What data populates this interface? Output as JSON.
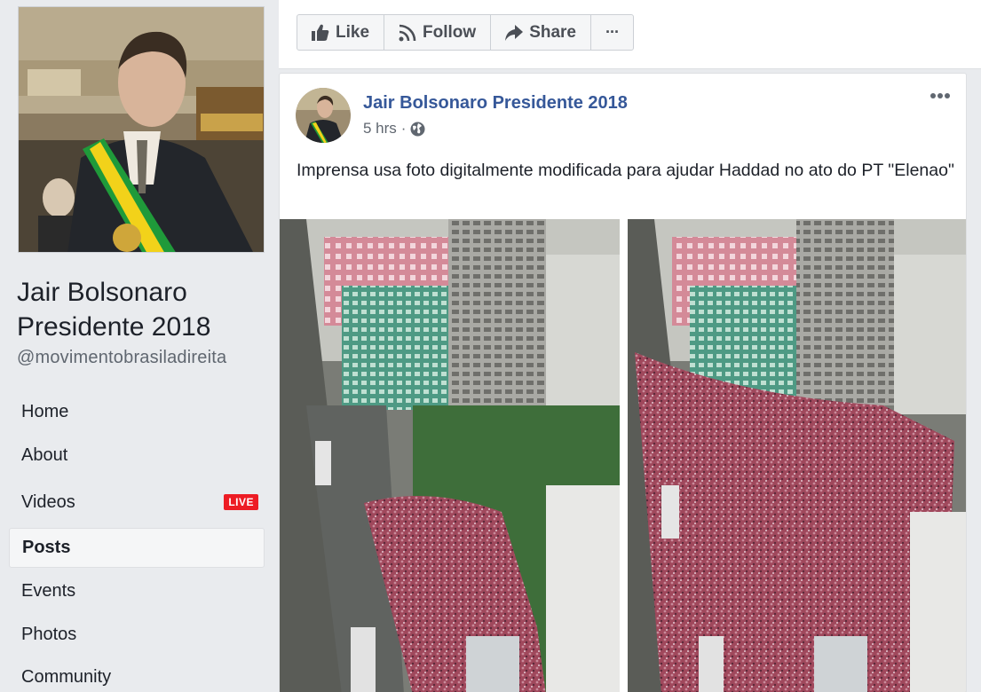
{
  "page": {
    "name": "Jair Bolsonaro Presidente 2018",
    "handle": "@movimentobrasiladireita"
  },
  "nav": {
    "items": [
      {
        "label": "Home"
      },
      {
        "label": "About"
      },
      {
        "label": "Videos",
        "badge": "LIVE"
      },
      {
        "label": "Posts",
        "active": true
      },
      {
        "label": "Events"
      },
      {
        "label": "Photos"
      },
      {
        "label": "Community"
      }
    ]
  },
  "actions": {
    "like": "Like",
    "follow": "Follow",
    "share": "Share",
    "more": "···"
  },
  "post": {
    "author": "Jair Bolsonaro Presidente 2018",
    "time": "5 hrs",
    "separator": "·",
    "privacy_icon": "globe-icon",
    "text": "Imprensa usa foto digitalmente modificada para ajudar Haddad no ato do PT \"Elenao\"",
    "menu_icon": "more-dots-icon"
  },
  "colors": {
    "link": "#365899",
    "live": "#ed1c24",
    "background": "#e9ebee"
  }
}
